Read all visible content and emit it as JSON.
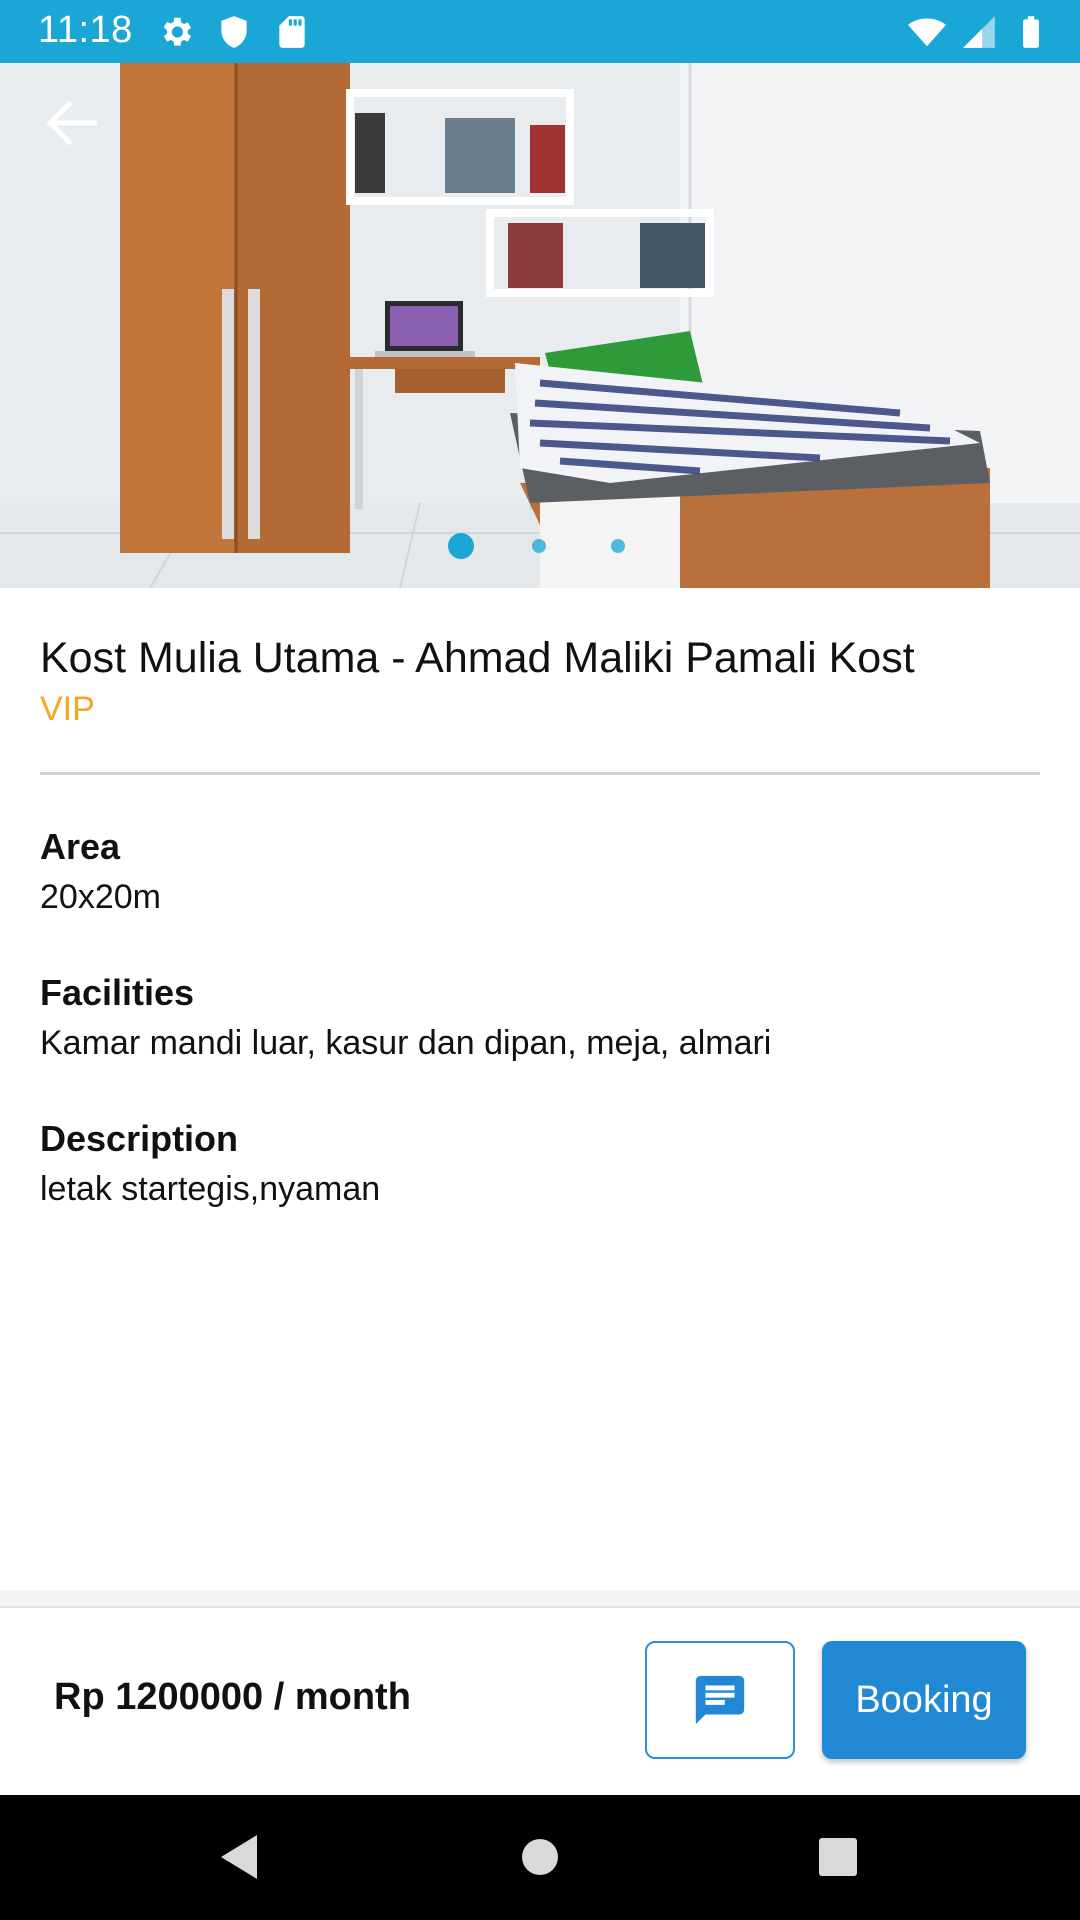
{
  "status_bar": {
    "time": "11:18",
    "left_icons": [
      "gear-icon",
      "shield-icon",
      "sd-card-icon"
    ],
    "right_icons": [
      "wifi-icon",
      "signal-icon",
      "battery-icon"
    ],
    "color": "#1aa7d6"
  },
  "hero": {
    "image": "bedroom-photo",
    "carousel": {
      "total": 3,
      "active_index": 0
    }
  },
  "listing": {
    "title": "Kost Mulia Utama -  Ahmad Maliki Pamali Kost",
    "room_type": "VIP",
    "room_type_color": "#f5a623"
  },
  "details": [
    {
      "label": "Area",
      "value": "20x20m"
    },
    {
      "label": "Facilities",
      "value": "Kamar mandi luar, kasur dan dipan, meja, almari"
    },
    {
      "label": "Description",
      "value": "letak startegis,nyaman"
    }
  ],
  "footer": {
    "price": "Rp 1200000 / month",
    "chat_icon": "chat-icon",
    "booking_label": "Booking",
    "accent_color": "#2188d4"
  },
  "nav_bar": {
    "buttons": [
      "back-triangle-icon",
      "home-circle-icon",
      "recents-square-icon"
    ]
  }
}
